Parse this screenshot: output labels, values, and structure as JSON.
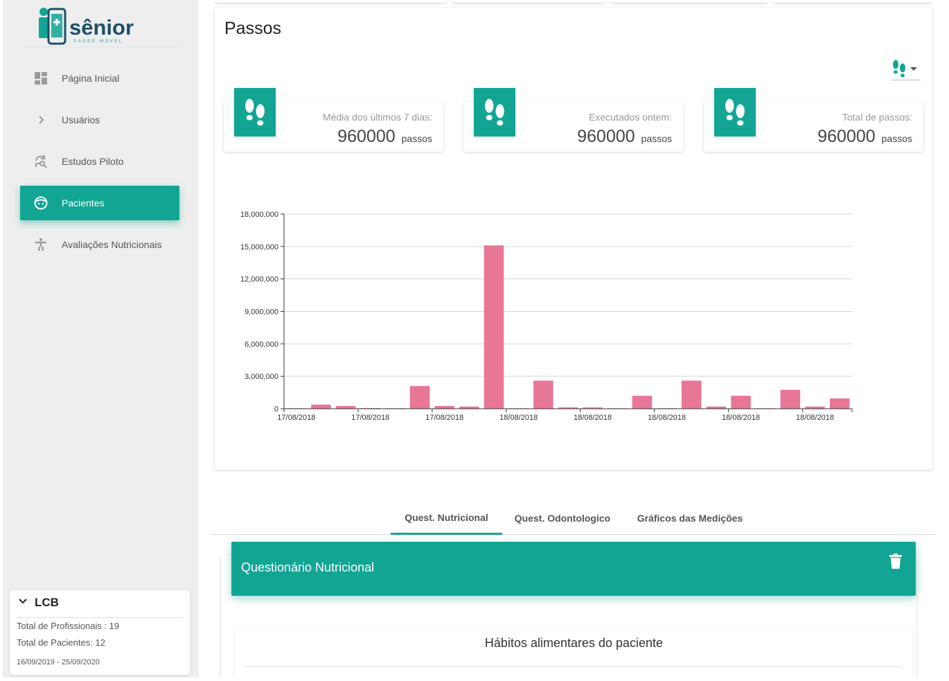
{
  "brand": {
    "name": "sênior",
    "tagline": "SAÚDE MÓVEL",
    "color": "#12a594",
    "dark_color": "#1b4f6a"
  },
  "sidebar": {
    "items": [
      {
        "label": "Página Inicial",
        "icon": "dashboard-icon",
        "active": false
      },
      {
        "label": "Usuários",
        "icon": "chevron-right-icon",
        "active": false
      },
      {
        "label": "Estudos Piloto",
        "icon": "refresh-search-icon",
        "active": false
      },
      {
        "label": "Pacientes",
        "icon": "face-icon",
        "active": true
      },
      {
        "label": "Avaliações Nutricionais",
        "icon": "accessibility-icon",
        "active": false
      }
    ],
    "org": {
      "name": "LCB",
      "professionals": "Total de Profissionais : 19",
      "patients": "Total de Pacientes: 12",
      "period": "16/09/2019 - 25/09/2020"
    }
  },
  "steps": {
    "title": "Passos",
    "selector_icon": "footprints-icon",
    "stats": [
      {
        "label": "Média dos últimos 7 dias:",
        "value": "960000",
        "unit": "passos"
      },
      {
        "label": "Executados ontem:",
        "value": "960000",
        "unit": "passos"
      },
      {
        "label": "Total de passos:",
        "value": "960000",
        "unit": "passos"
      }
    ]
  },
  "chart_data": {
    "type": "bar",
    "color": "#e87695",
    "ylim": [
      0,
      18000000
    ],
    "yticks": [
      0,
      3000000,
      6000000,
      9000000,
      12000000,
      15000000,
      18000000
    ],
    "ytick_labels": [
      "0",
      "3,000,000",
      "6,000,000",
      "9,000,000",
      "12,000,000",
      "15,000,000",
      "18,000,000"
    ],
    "xtick_labels": [
      "17/08/2018",
      "17/08/2018",
      "17/08/2018",
      "18/08/2018",
      "18/08/2018",
      "18/08/2018",
      "18/08/2018",
      "18/08/2018"
    ],
    "grid": true,
    "values": [
      50000,
      380000,
      250000,
      60000,
      50000,
      2100000,
      250000,
      200000,
      15100000,
      50000,
      2600000,
      120000,
      120000,
      50000,
      1200000,
      50000,
      2600000,
      200000,
      1200000,
      50000,
      1750000,
      200000,
      950000
    ]
  },
  "tabs": [
    {
      "label": "Quest. Nutricional",
      "active": true
    },
    {
      "label": "Quest. Odontologico",
      "active": false
    },
    {
      "label": "Gráficos das Medições",
      "active": false
    }
  ],
  "questionnaire": {
    "title": "Questionário Nutricional",
    "section_title": "Hábitos alimentares do paciente"
  }
}
